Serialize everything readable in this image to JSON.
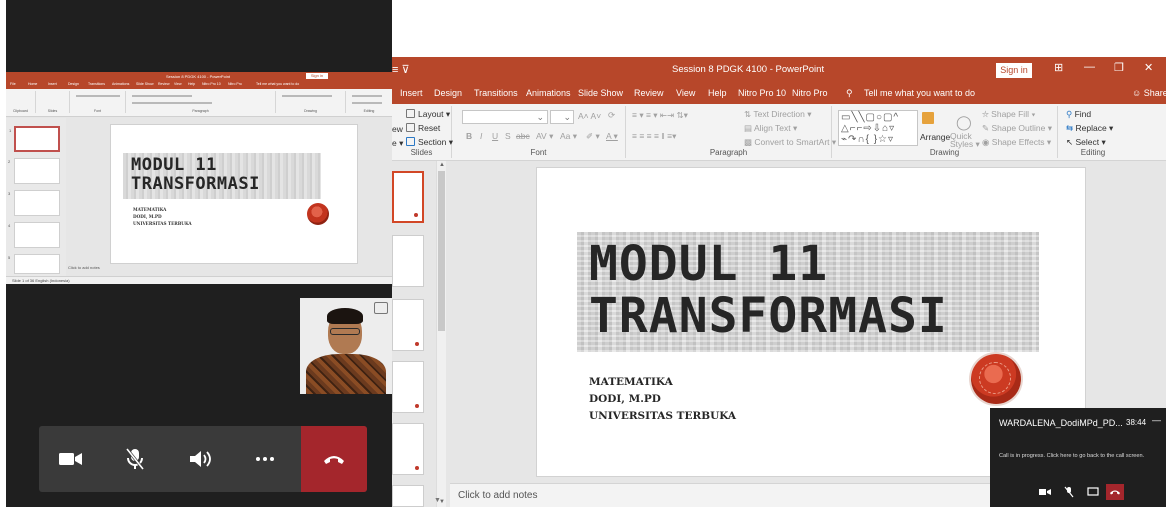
{
  "meeting": {
    "mini_window": {
      "doc_title": "Session 8 PDGK 4100 - PowerPoint",
      "signin": "Sign in",
      "tabs": [
        "File",
        "Home",
        "Insert",
        "Design",
        "Transitions",
        "Animations",
        "Slide Show",
        "Review",
        "View",
        "Help",
        "Nitro Pro 10",
        "Nitro Pro",
        "Tell me what you want to do"
      ],
      "groups": [
        "Clipboard",
        "Slides",
        "Font",
        "Paragraph",
        "Drawing",
        "Editing"
      ],
      "slide_title_line1": "MODUL 11",
      "slide_title_line2": "TRANSFORMASI",
      "slide_sub_line1": "MATEMATIKA",
      "slide_sub_line2": "DODI, M.PD",
      "slide_sub_line3": "UNIVERSITAS TERBUKA",
      "notes": "Click to add notes",
      "status": "Slide 1 of 36   English (Indonesia)"
    },
    "self_view": {
      "icon": "screen-share-icon"
    },
    "controls": {
      "camera": "video-camera-icon",
      "mic": "microphone-muted-icon",
      "speaker": "speaker-icon",
      "more": "more-options-icon",
      "end": "hang-up-icon",
      "end_color": "#a4262c"
    }
  },
  "ppt": {
    "qat": "≡ ⊽",
    "doc_title": "Session 8 PDGK 4100  -  PowerPoint",
    "signin": "Sign in",
    "window_controls": [
      "⊞",
      "—",
      "❐",
      "✕"
    ],
    "tabs": {
      "insert": "Insert",
      "design": "Design",
      "transitions": "Transitions",
      "animations": "Animations",
      "slideshow": "Slide Show",
      "review": "Review",
      "view": "View",
      "help": "Help",
      "nitro10": "Nitro Pro 10",
      "nitro": "Nitro Pro",
      "tellme": "Tell me what you want to do",
      "share": "Share"
    },
    "ribbon": {
      "slides": {
        "layout": "Layout ▾",
        "reset": "Reset",
        "section": "Section ▾",
        "label": "Slides",
        "new_part": "ew",
        "new_part2": "e ▾"
      },
      "font": {
        "size_buttons": "A˄ A˅",
        "bold": "B",
        "italic": "I",
        "underline": "U",
        "strike": "S",
        "abc": "abc",
        "spacing": "AV ▾",
        "case": "Aa ▾",
        "label": "Font"
      },
      "paragraph": {
        "text_direction": "Text Direction ▾",
        "align_text": "Align Text ▾",
        "smartart": "Convert to SmartArt ▾",
        "label": "Paragraph"
      },
      "drawing": {
        "shapes": "▭╲╲▢○▢^ △⌐⌐⇨⇩⌂▿ ⌁↷∩{ }☆▿",
        "arrange": "Arrange",
        "quick_styles": "Quick Styles ▾",
        "fill": "Shape Fill ▾",
        "outline": "Shape Outline ▾",
        "effects": "Shape Effects ▾",
        "label": "Drawing"
      },
      "editing": {
        "find": "Find",
        "replace": "Replace ▾",
        "select": "Select ▾",
        "label": "Editing"
      }
    },
    "slide": {
      "title_line1": "MODUL 11",
      "title_line2": "TRANSFORMASI",
      "sub_line1": "MATEMATIKA",
      "sub_line2": "DODI, M.PD",
      "sub_line3": "UNIVERSITAS TERBUKA"
    },
    "notes_placeholder": "Click to add notes",
    "accent": "#b7472a"
  },
  "call_popup": {
    "name": "WARDALENA_DodiMPd_PD...",
    "time": "38:44",
    "minimize": "—",
    "message": "Call is in progress. Click here to go back to the call screen."
  }
}
